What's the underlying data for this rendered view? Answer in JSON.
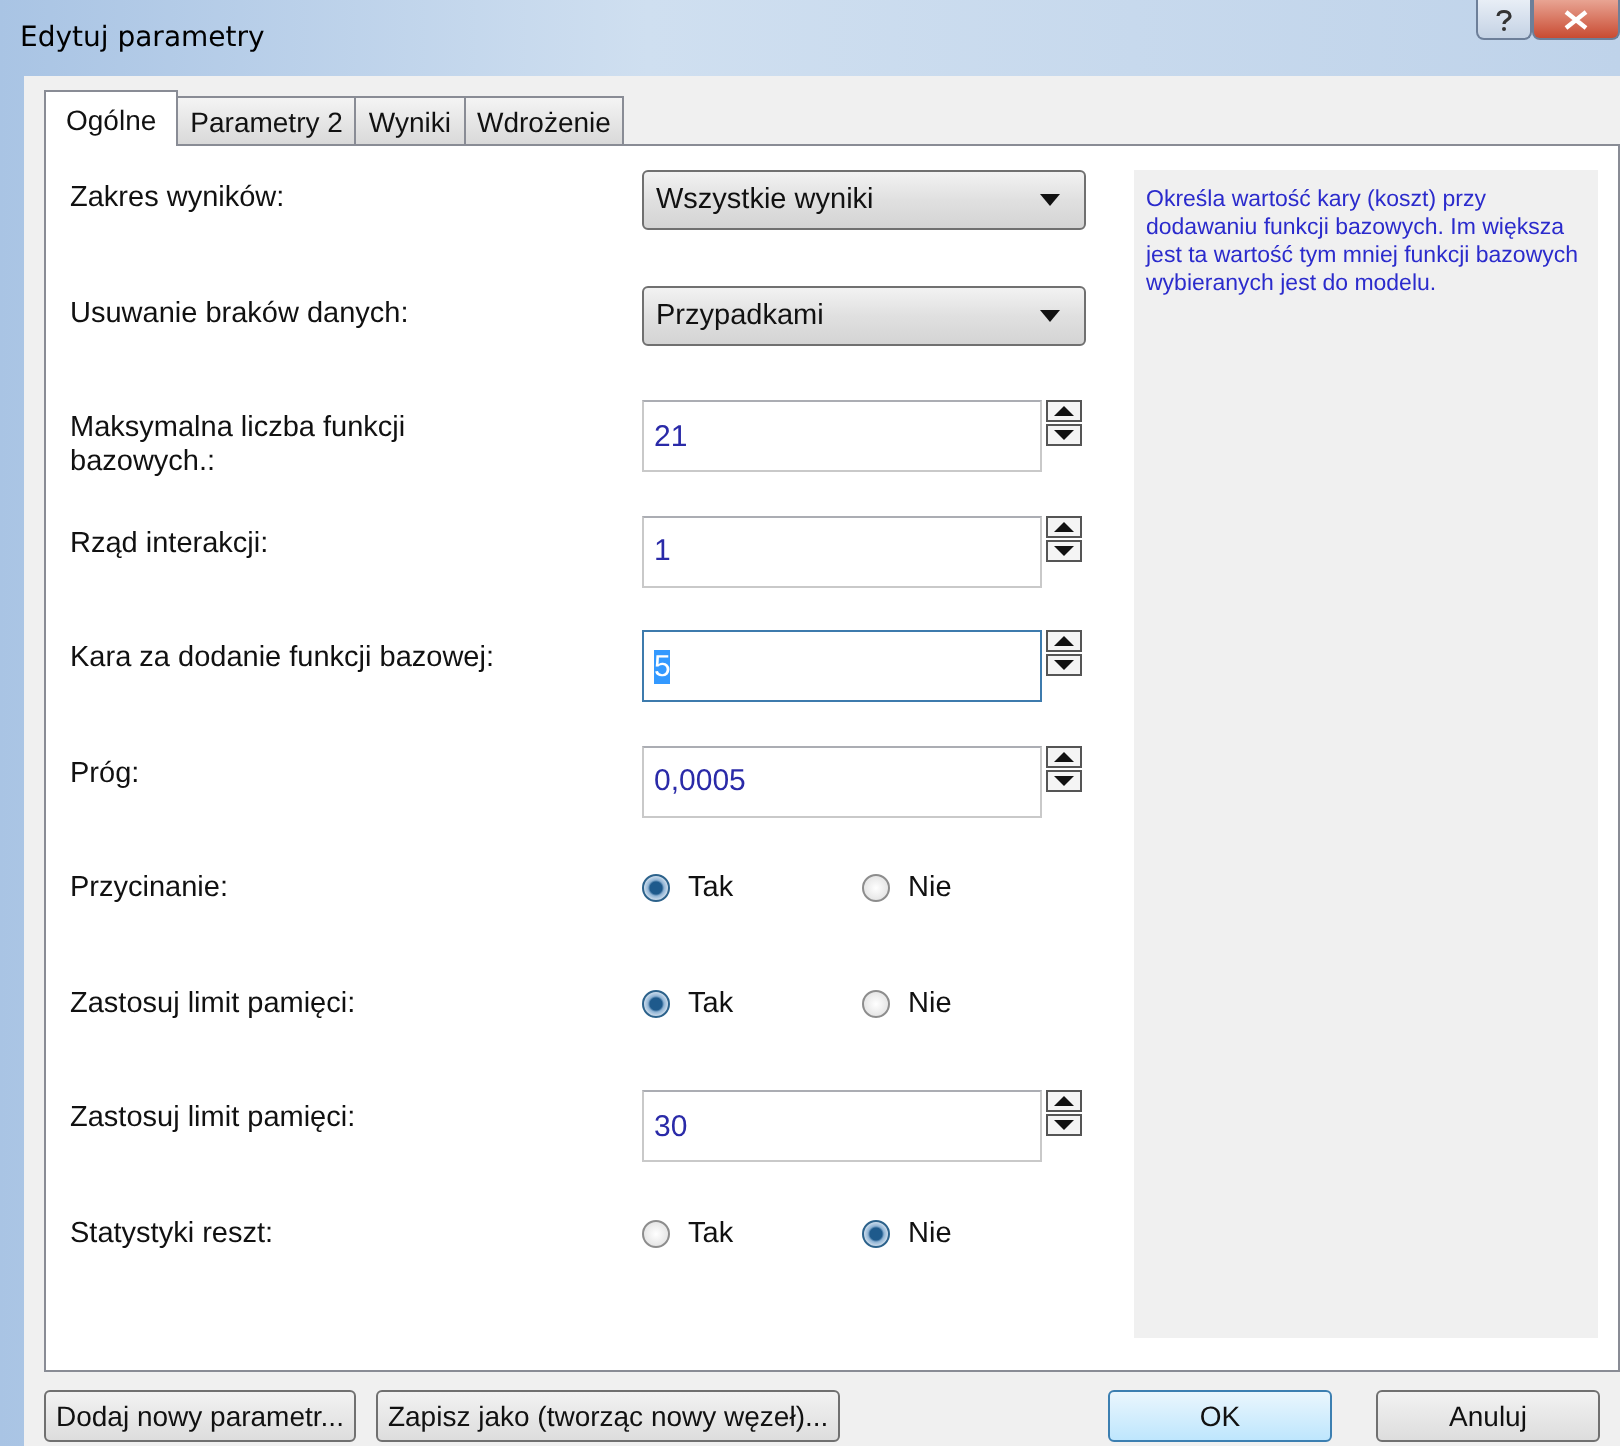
{
  "window": {
    "title": "Edytuj parametry"
  },
  "tabs": [
    {
      "label": "Ogólne",
      "selected": true
    },
    {
      "label": "Parametry 2",
      "selected": false
    },
    {
      "label": "Wyniki",
      "selected": false
    },
    {
      "label": "Wdrożenie",
      "selected": false
    }
  ],
  "fields": [
    {
      "kind": "select",
      "label": "Zakres wyników:",
      "value": "Wszystkie wyniki"
    },
    {
      "kind": "select",
      "label": "Usuwanie braków danych:",
      "value": "Przypadkami"
    },
    {
      "kind": "spin",
      "label": "Maksymalna liczba funkcji bazowych.:",
      "value": "21",
      "focused": false
    },
    {
      "kind": "spin",
      "label": "Rząd interakcji:",
      "value": "1",
      "focused": false
    },
    {
      "kind": "spin",
      "label": "Kara za dodanie funkcji bazowej:",
      "value": "5",
      "focused": true
    },
    {
      "kind": "spin",
      "label": "Próg:",
      "value": "0,0005",
      "focused": false
    },
    {
      "kind": "radio",
      "label": "Przycinanie:",
      "options": [
        {
          "label": "Tak",
          "selected": true
        },
        {
          "label": "Nie",
          "selected": false
        }
      ]
    },
    {
      "kind": "radio",
      "label": "Zastosuj limit pamięci:",
      "options": [
        {
          "label": "Tak",
          "selected": true
        },
        {
          "label": "Nie",
          "selected": false
        }
      ]
    },
    {
      "kind": "spin",
      "label": "Zastosuj limit pamięci:",
      "value": "30",
      "focused": false
    },
    {
      "kind": "radio",
      "label": "Statystyki reszt:",
      "options": [
        {
          "label": "Tak",
          "selected": false
        },
        {
          "label": "Nie",
          "selected": true
        }
      ]
    }
  ],
  "help_text": "Określa wartość kary (koszt) przy dodawaniu funkcji bazowych. Im większa jest ta wartość tym mniej funkcji bazowych wybieranych jest do modelu.",
  "buttons": [
    {
      "label": "Dodaj nowy parametr...",
      "kind": "left"
    },
    {
      "label": "Zapisz jako (tworząc nowy węzeł)...",
      "kind": "left"
    },
    {
      "label": "OK",
      "kind": "default"
    },
    {
      "label": "Anuluj",
      "kind": "right"
    }
  ]
}
